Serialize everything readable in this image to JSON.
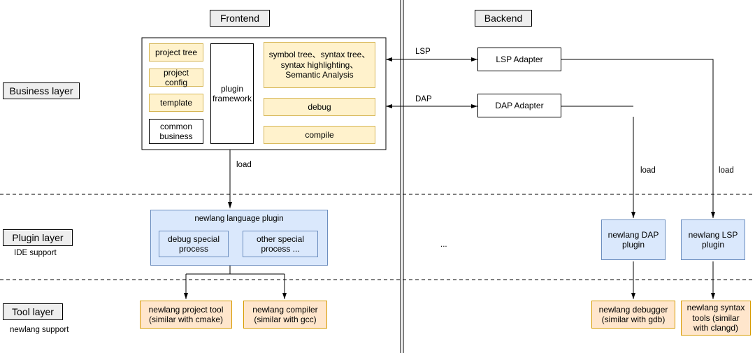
{
  "sections": {
    "frontend": "Frontend",
    "backend": "Backend"
  },
  "layers": {
    "business": "Business layer",
    "plugin": "Plugin layer",
    "plugin_sub": "IDE support",
    "tool": "Tool layer",
    "tool_sub": "newlang support"
  },
  "frontend_business": {
    "items_left": {
      "project_tree": "project tree",
      "project_config": "project config",
      "template": "template",
      "common_business": "common business"
    },
    "plugin_framework": "plugin framework",
    "items_right": {
      "syntax": "symbol tree、syntax tree、syntax highlighting、Semantic Analysis",
      "debug": "debug",
      "compile": "compile"
    }
  },
  "backend_business": {
    "lsp_adapter": "LSP Adapter",
    "dap_adapter": "DAP Adapter"
  },
  "edges": {
    "lsp": "LSP",
    "dap": "DAP",
    "load1": "load",
    "load2": "load",
    "load3": "load"
  },
  "plugin_layer": {
    "newlang_plugin_title": "newlang language plugin",
    "debug_special": "debug special process",
    "other_special": "other special process ...",
    "ellipsis": "...",
    "dap_plugin": "newlang DAP plugin",
    "lsp_plugin": "newlang LSP plugin"
  },
  "tool_layer": {
    "project_tool": "newlang project tool (similar with cmake)",
    "compiler": "newlang compiler (similar with gcc)",
    "debugger": "newlang debugger (similar with gdb)",
    "syntax_tools": "newlang syntax tools (similar with clangd)"
  }
}
